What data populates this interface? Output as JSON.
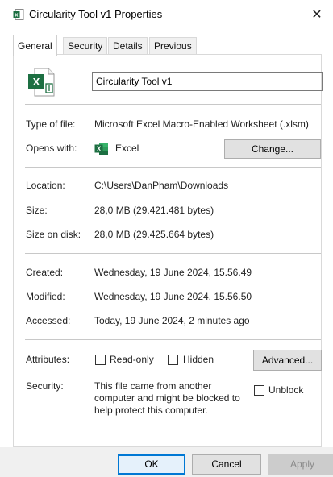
{
  "window": {
    "title": "Circularity Tool v1 Properties",
    "close_glyph": "✕"
  },
  "tabs": [
    {
      "label": "General",
      "active": true
    },
    {
      "label": "Security",
      "active": false
    },
    {
      "label": "Details",
      "active": false
    },
    {
      "label": "Previous Versions",
      "active": false
    }
  ],
  "file": {
    "name": "Circularity Tool v1",
    "icon": "excel-xlsm-file-icon",
    "brand_color": "#1d6f42"
  },
  "info": {
    "type_label": "Type of file:",
    "type_value": "Microsoft Excel Macro-Enabled Worksheet (.xlsm)",
    "opens_label": "Opens with:",
    "opens_value": "Excel",
    "change_label": "Change...",
    "location_label": "Location:",
    "location_value": "C:\\Users\\DanPham\\Downloads",
    "size_label": "Size:",
    "size_value": "28,0 MB (29.421.481 bytes)",
    "sizeondisk_label": "Size on disk:",
    "sizeondisk_value": "28,0 MB (29.425.664 bytes)",
    "created_label": "Created:",
    "created_value": "Wednesday, 19 June 2024, 15.56.49",
    "modified_label": "Modified:",
    "modified_value": "Wednesday, 19 June 2024, 15.56.50",
    "accessed_label": "Accessed:",
    "accessed_value": "Today, 19 June 2024, 2 minutes ago"
  },
  "attributes": {
    "label": "Attributes:",
    "readonly_label": "Read-only",
    "readonly_checked": false,
    "hidden_label": "Hidden",
    "hidden_checked": false,
    "advanced_label": "Advanced..."
  },
  "security": {
    "label": "Security:",
    "message": "This file came from another computer and might be blocked to help protect this computer.",
    "unblock_label": "Unblock",
    "unblock_checked": false
  },
  "buttons": {
    "ok": "OK",
    "cancel": "Cancel",
    "apply": "Apply"
  }
}
